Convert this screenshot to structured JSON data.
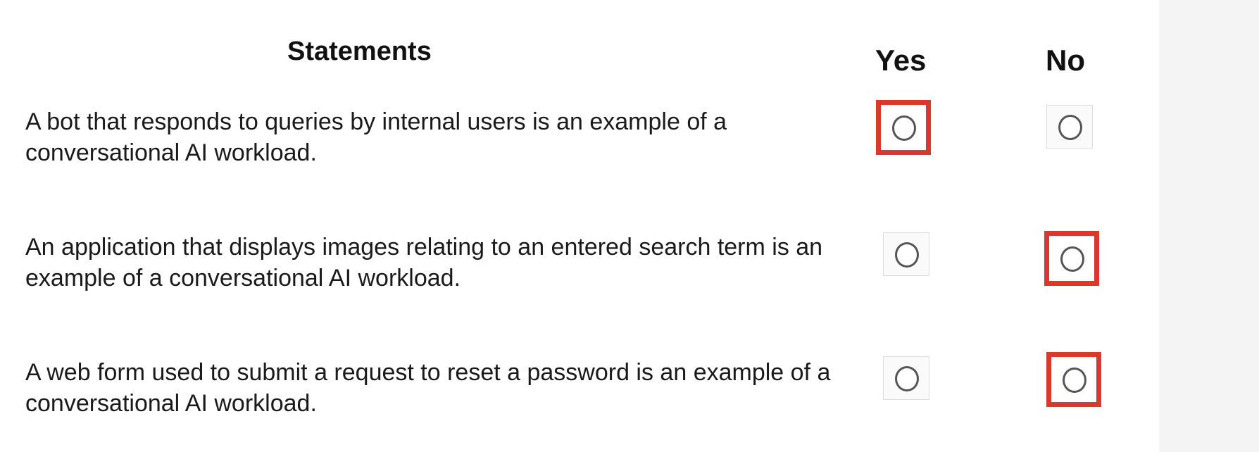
{
  "headers": {
    "statements": "Statements",
    "yes": "Yes",
    "no": "No"
  },
  "rows": [
    {
      "statement": "A bot that responds to queries by internal users is an example of a conversational AI workload.",
      "answer": "Yes"
    },
    {
      "statement": "An application that displays images relating to an entered search term is an example of a conversational AI workload.",
      "answer": "No"
    },
    {
      "statement": "A web form used to submit a request to reset a password is an example of a conversational AI workload.",
      "answer": "No"
    }
  ],
  "colors": {
    "highlight": "#d9392c",
    "radio_border": "#555555",
    "side_panel": "#f4f4f5"
  },
  "icons": {
    "radio": "radio-circle-icon"
  }
}
